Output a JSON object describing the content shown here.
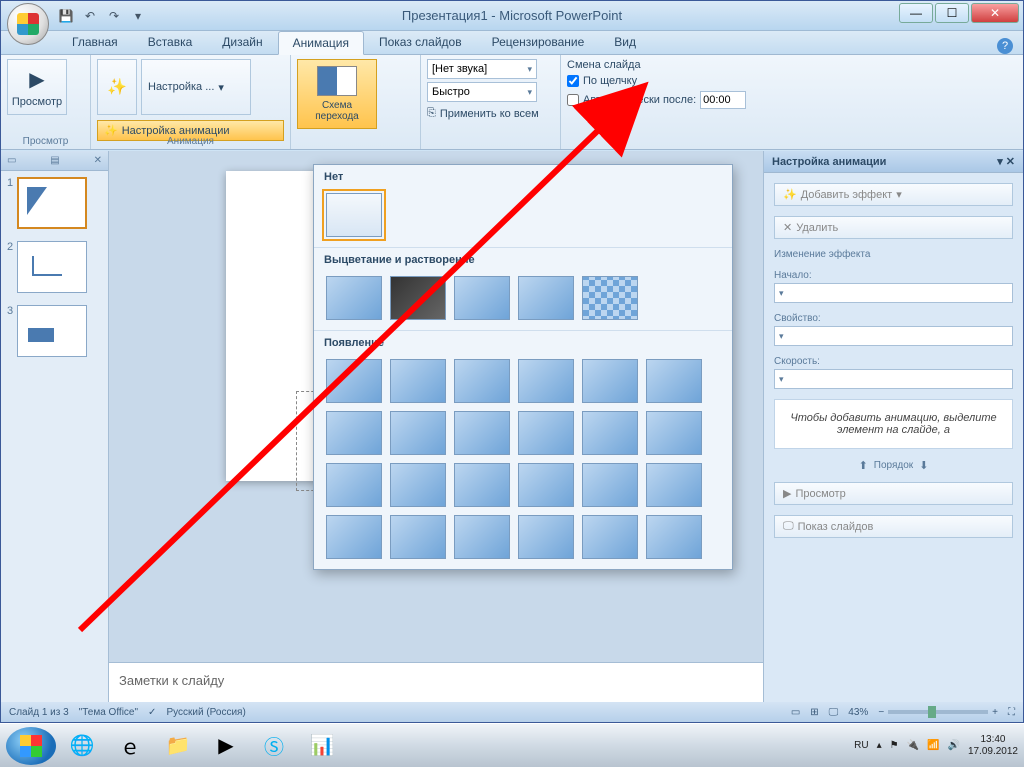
{
  "title": "Презентация1 - Microsoft PowerPoint",
  "tabs": [
    "Главная",
    "Вставка",
    "Дизайн",
    "Анимация",
    "Показ слайдов",
    "Рецензирование",
    "Вид"
  ],
  "ribbon": {
    "preview": "Просмотр",
    "preview_group": "Просмотр",
    "custom": "Настройка ...",
    "custom_anim": "Настройка анимации",
    "anim_group": "Анимация",
    "scheme": "Схема перехода",
    "sound_label": "[Нет звука]",
    "speed_label": "Быстро",
    "apply_all": "Применить ко всем",
    "slide_change": "Смена слайда",
    "on_click": "По щелчку",
    "auto_after": "Автоматически после:",
    "auto_time": "00:00"
  },
  "gallery": {
    "none": "Нет",
    "fade": "Выцветание и растворение",
    "appear": "Появление"
  },
  "slides": [
    "1",
    "2",
    "3"
  ],
  "notes": "Заметки к слайду",
  "anim_pane": {
    "title": "Настройка анимации",
    "add_effect": "Добавить эффект",
    "remove": "Удалить",
    "change": "Изменение эффекта",
    "start": "Начало:",
    "property": "Свойство:",
    "speed": "Скорость:",
    "hint": "Чтобы добавить анимацию, выделите элемент на слайде, а",
    "order": "Порядок",
    "preview": "Просмотр",
    "slideshow": "Показ слайдов"
  },
  "status": {
    "slide": "Слайд 1 из 3",
    "theme": "\"Тема Office\"",
    "lang": "Русский (Россия)",
    "zoom": "43%"
  },
  "tray": {
    "lang": "RU",
    "time": "13:40",
    "date": "17.09.2012"
  }
}
